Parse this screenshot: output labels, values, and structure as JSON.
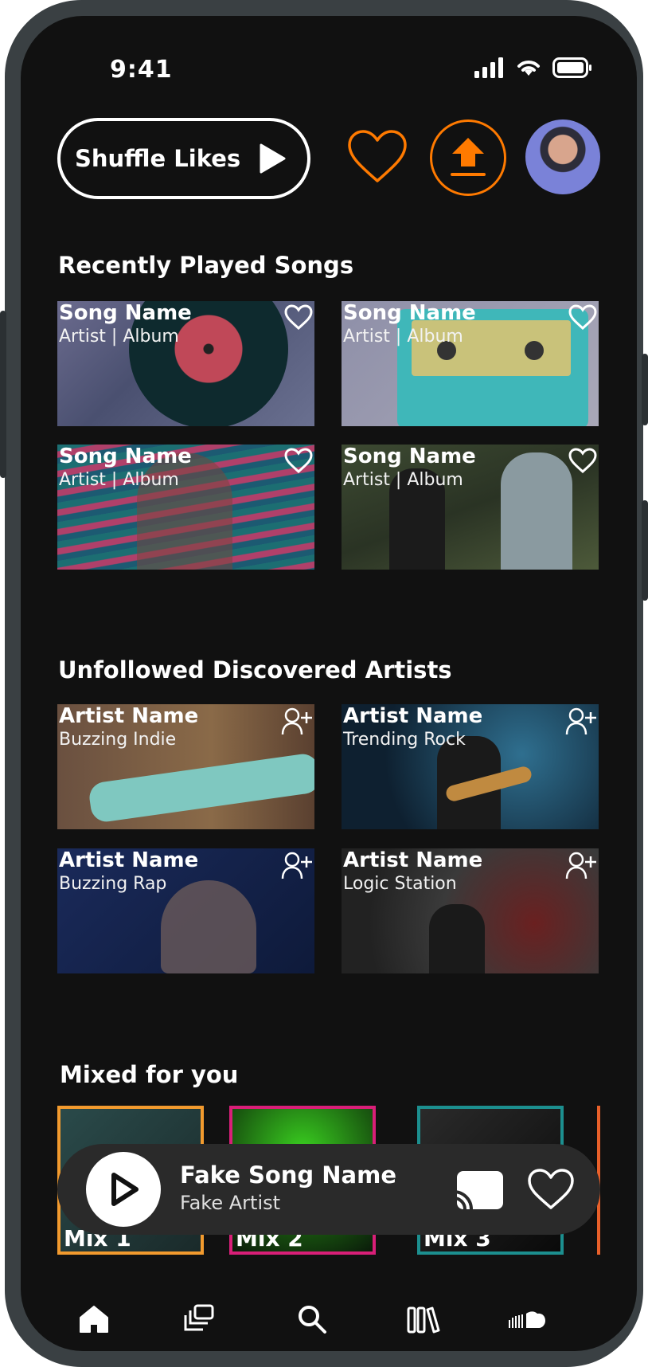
{
  "status_bar": {
    "time": "9:41"
  },
  "header": {
    "shuffle_label": "Shuffle Likes",
    "accent_color": "#ff7a00"
  },
  "recently_played": {
    "title": "Recently Played Songs",
    "items": [
      {
        "title": "Song Name",
        "subtitle": "Artist | Album"
      },
      {
        "title": "Song Name",
        "subtitle": "Artist | Album"
      },
      {
        "title": "Song Name",
        "subtitle": "Artist | Album"
      },
      {
        "title": "Song Name",
        "subtitle": "Artist | Album"
      }
    ]
  },
  "discovered_artists": {
    "title": "Unfollowed  Discovered Artists",
    "items": [
      {
        "title": "Artist Name",
        "subtitle": "Buzzing Indie"
      },
      {
        "title": "Artist Name",
        "subtitle": "Trending Rock"
      },
      {
        "title": "Artist Name",
        "subtitle": "Buzzing Rap"
      },
      {
        "title": "Artist Name",
        "subtitle": "Logic Station"
      }
    ]
  },
  "mixed_for_you": {
    "title": "Mixed for you",
    "items": [
      {
        "label": "Mix 1",
        "border_color": "#f29a2e"
      },
      {
        "label": "Mix 2",
        "border_color": "#d81f78"
      },
      {
        "label": "Mix 3",
        "border_color": "#1c8f8f"
      }
    ]
  },
  "now_playing": {
    "song": "Fake Song Name",
    "artist": "Fake Artist"
  },
  "bottom_nav": [
    "home-icon",
    "library-stack-icon",
    "search-icon",
    "collection-icon",
    "soundcloud-icon"
  ]
}
